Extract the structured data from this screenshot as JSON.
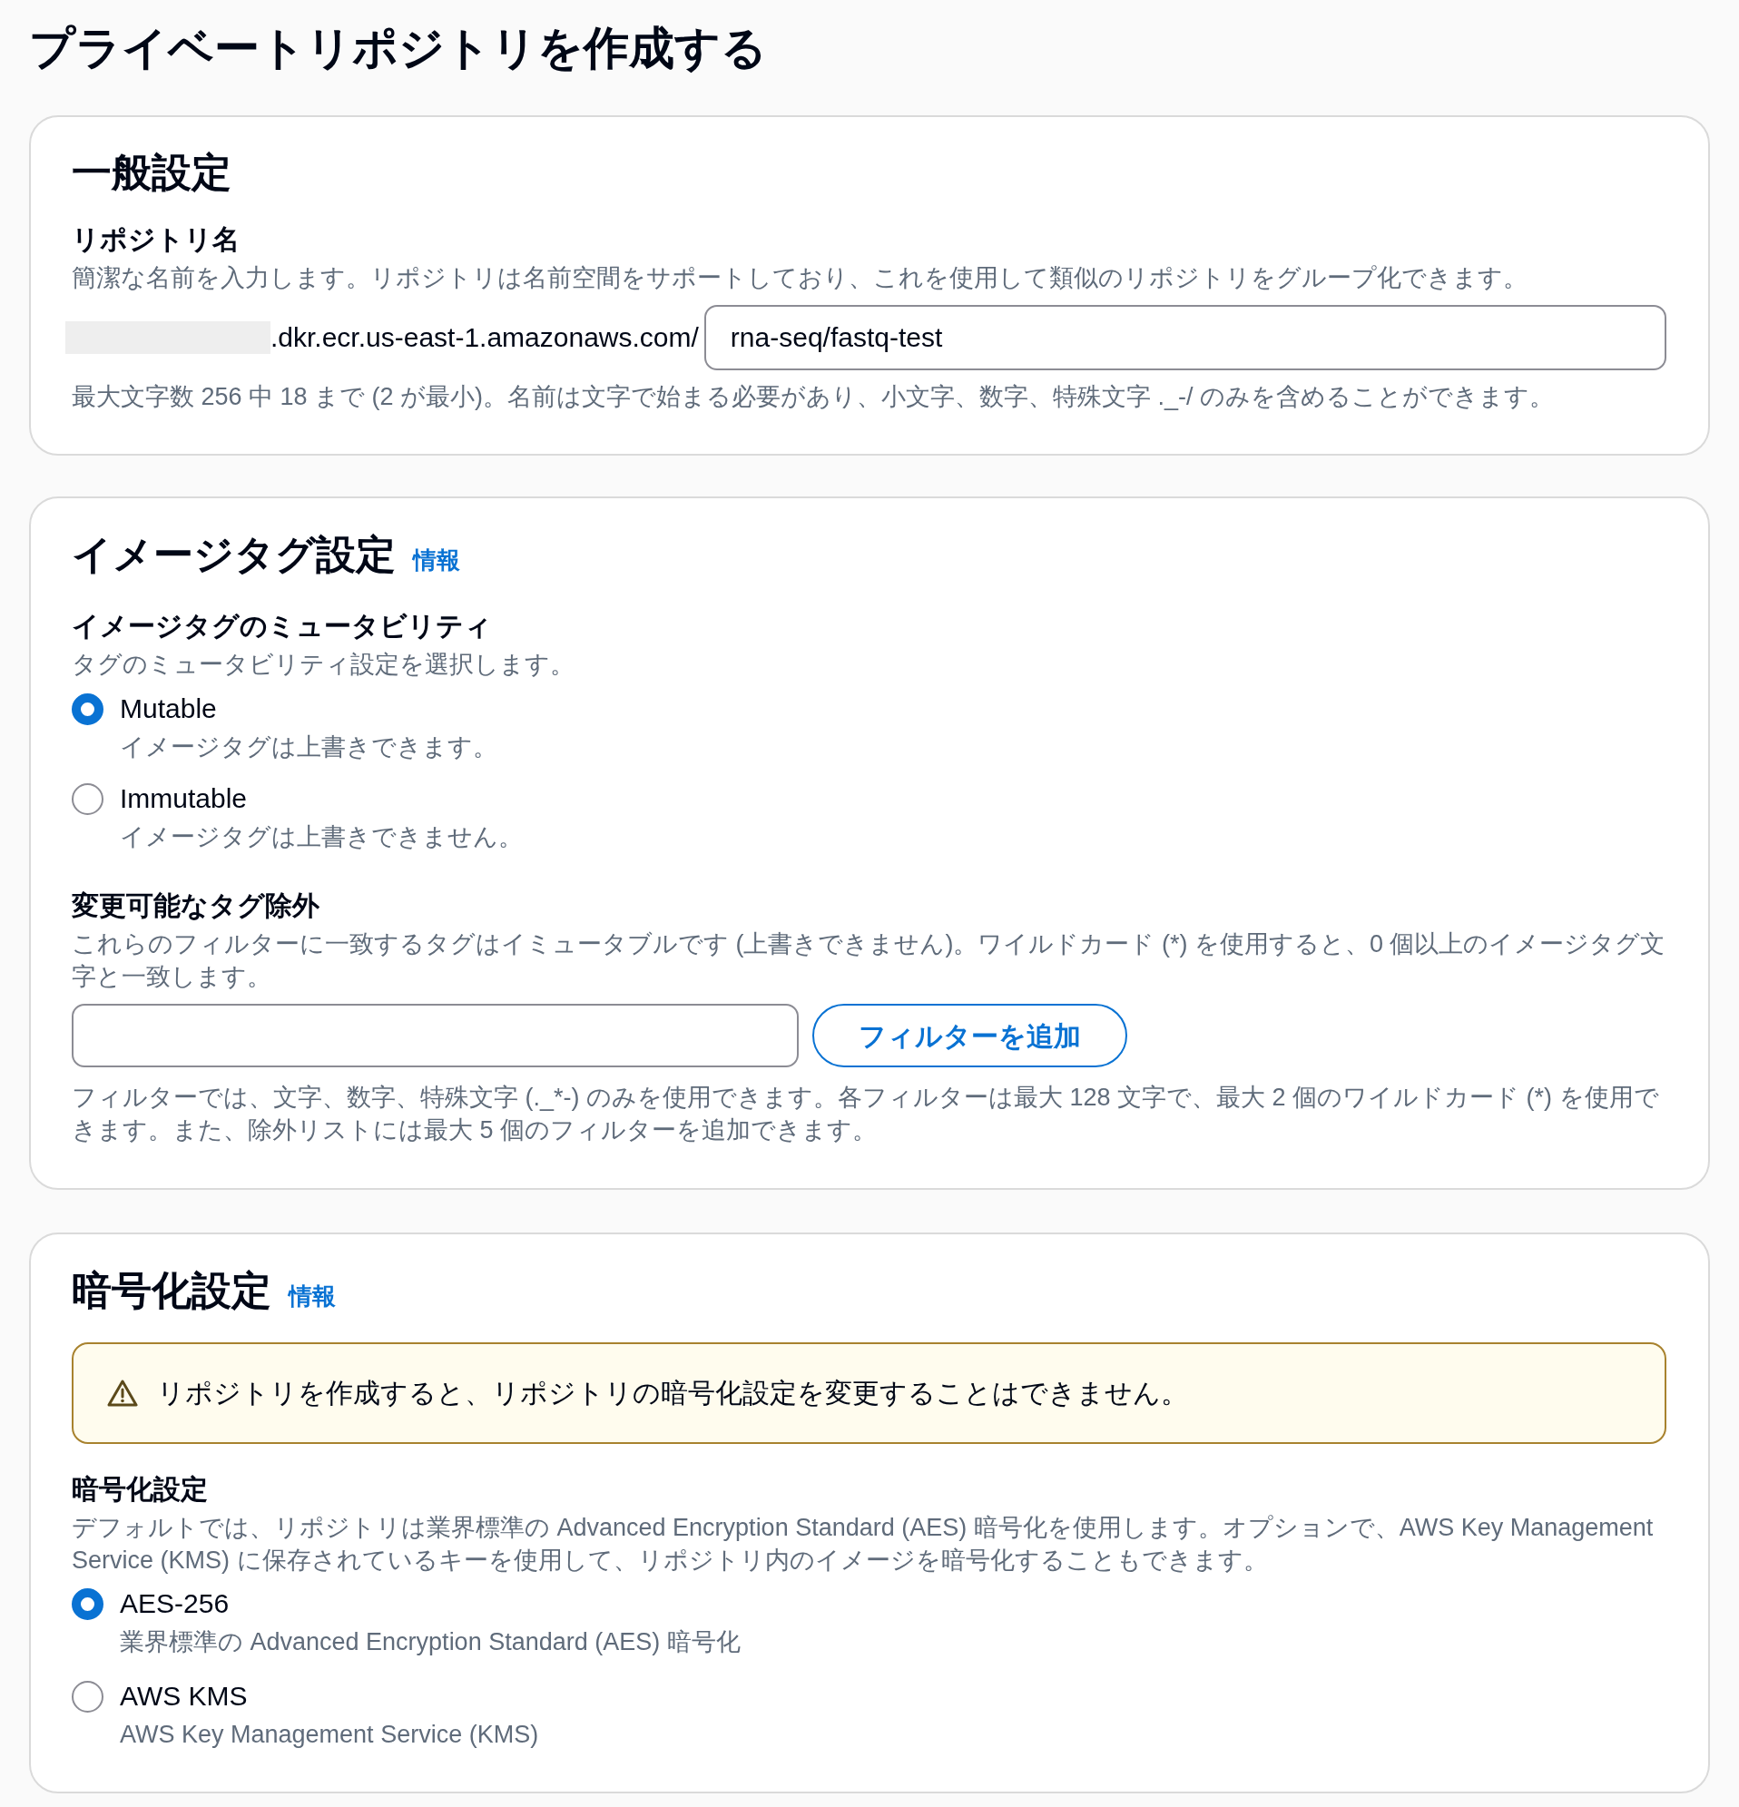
{
  "page": {
    "title": "プライベートリポジトリを作成する"
  },
  "general_settings": {
    "heading": "一般設定",
    "repository_name": {
      "label": "リポジトリ名",
      "description": "簡潔な名前を入力します。リポジトリは名前空間をサポートしており、これを使用して類似のリポジトリをグループ化できます。",
      "prefix": ".dkr.ecr.us-east-1.amazonaws.com/",
      "value": "rna-seq/fastq-test",
      "constraint": "最大文字数 256 中 18 まで (2 が最小)。名前は文字で始まる必要があり、小文字、数字、特殊文字 ._-/ のみを含めることができます。"
    }
  },
  "image_tag_settings": {
    "heading": "イメージタグ設定",
    "info_link": "情報",
    "mutability": {
      "label": "イメージタグのミュータビリティ",
      "description": "タグのミュータビリティ設定を選択します。",
      "options": [
        {
          "label": "Mutable",
          "description": "イメージタグは上書きできます。",
          "selected": true
        },
        {
          "label": "Immutable",
          "description": "イメージタグは上書きできません。",
          "selected": false
        }
      ]
    },
    "exclusions": {
      "label": "変更可能なタグ除外",
      "description": "これらのフィルターに一致するタグはイミュータブルです (上書きできません)。ワイルドカード (*) を使用すると、0 個以上のイメージタグ文字と一致します。",
      "add_button": "フィルターを追加",
      "help": "フィルターでは、文字、数字、特殊文字 (._*-) のみを使用できます。各フィルターは最大 128 文字で、最大 2 個のワイルドカード (*) を使用できます。また、除外リストには最大 5 個のフィルターを追加できます。"
    }
  },
  "encryption_settings": {
    "heading": "暗号化設定",
    "info_link": "情報",
    "warning": "リポジトリを作成すると、リポジトリの暗号化設定を変更することはできません。",
    "encryption": {
      "label": "暗号化設定",
      "description": "デフォルトでは、リポジトリは業界標準の Advanced Encryption Standard (AES) 暗号化を使用します。オプションで、AWS Key Management Service (KMS) に保存されているキーを使用して、リポジトリ内のイメージを暗号化することもできます。",
      "options": [
        {
          "label": "AES-256",
          "description": "業界標準の Advanced Encryption Standard (AES) 暗号化",
          "selected": true
        },
        {
          "label": "AWS KMS",
          "description": "AWS Key Management Service (KMS)",
          "selected": false
        }
      ]
    }
  }
}
